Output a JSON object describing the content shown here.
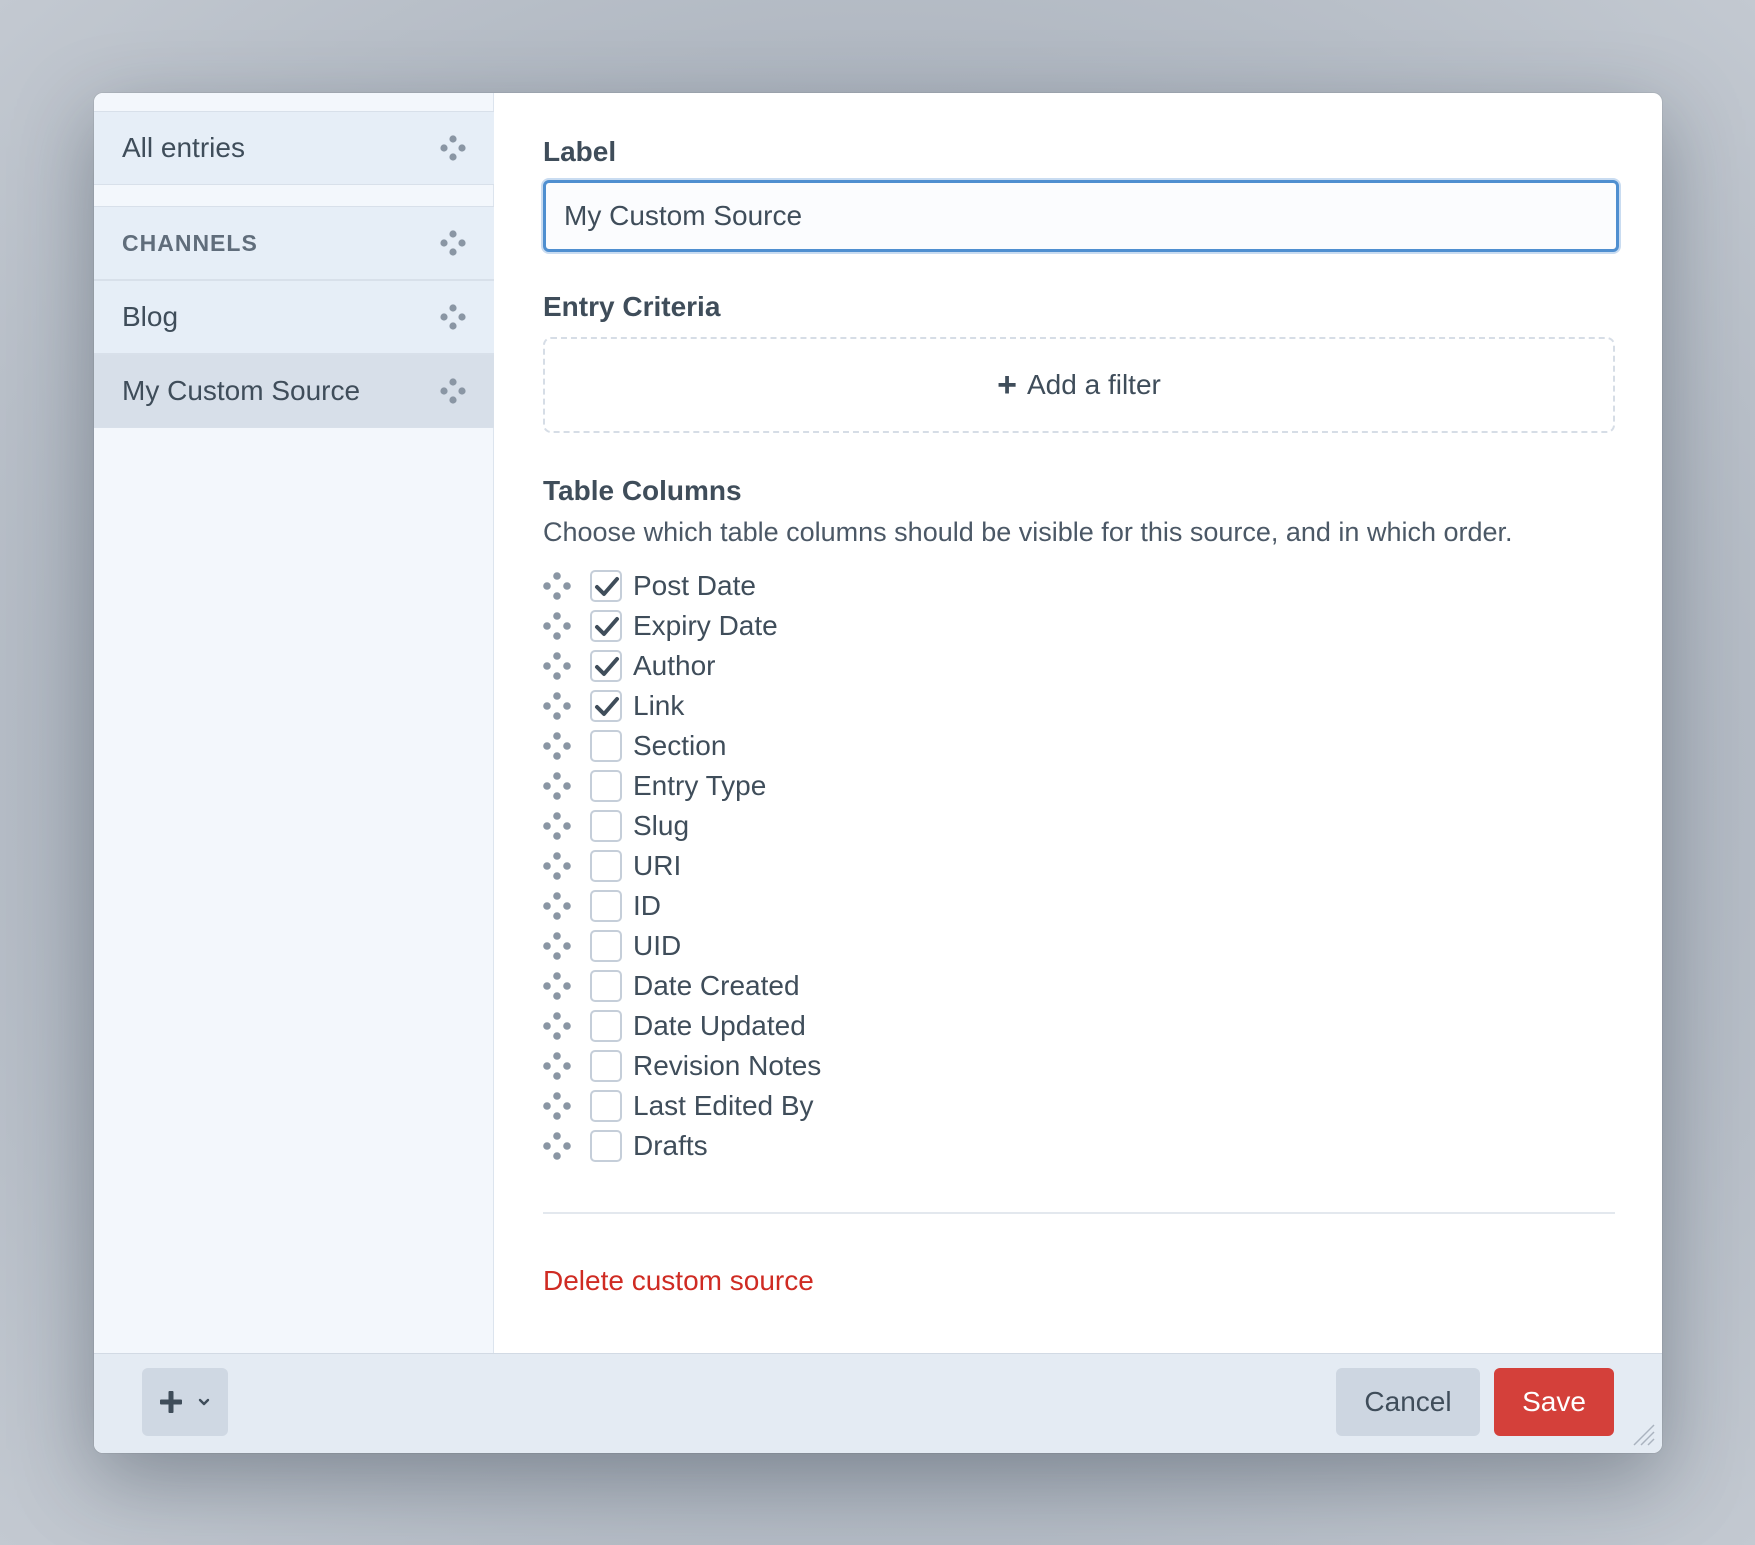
{
  "sidebar": {
    "items": [
      {
        "label": "All entries",
        "type": "item"
      },
      {
        "label": "CHANNELS",
        "type": "heading"
      },
      {
        "label": "Blog",
        "type": "item"
      },
      {
        "label": "My Custom Source",
        "type": "item",
        "selected": true
      }
    ]
  },
  "form": {
    "label_heading": "Label",
    "label_value": "My Custom Source",
    "criteria_heading": "Entry Criteria",
    "add_filter_label": "Add a filter",
    "columns_heading": "Table Columns",
    "columns_description": "Choose which table columns should be visible for this source, and in which order.",
    "columns": [
      {
        "label": "Post Date",
        "checked": true
      },
      {
        "label": "Expiry Date",
        "checked": true
      },
      {
        "label": "Author",
        "checked": true
      },
      {
        "label": "Link",
        "checked": true
      },
      {
        "label": "Section",
        "checked": false
      },
      {
        "label": "Entry Type",
        "checked": false
      },
      {
        "label": "Slug",
        "checked": false
      },
      {
        "label": "URI",
        "checked": false
      },
      {
        "label": "ID",
        "checked": false
      },
      {
        "label": "UID",
        "checked": false
      },
      {
        "label": "Date Created",
        "checked": false
      },
      {
        "label": "Date Updated",
        "checked": false
      },
      {
        "label": "Revision Notes",
        "checked": false
      },
      {
        "label": "Last Edited By",
        "checked": false
      },
      {
        "label": "Drafts",
        "checked": false
      }
    ],
    "delete_label": "Delete custom source"
  },
  "footer": {
    "add_icon": "plus-icon",
    "menu_icon": "chevron-down-icon",
    "cancel_label": "Cancel",
    "save_label": "Save"
  },
  "colors": {
    "accent": "#4f8fd0",
    "danger": "#cf2b23",
    "save_button": "#d4403a"
  }
}
